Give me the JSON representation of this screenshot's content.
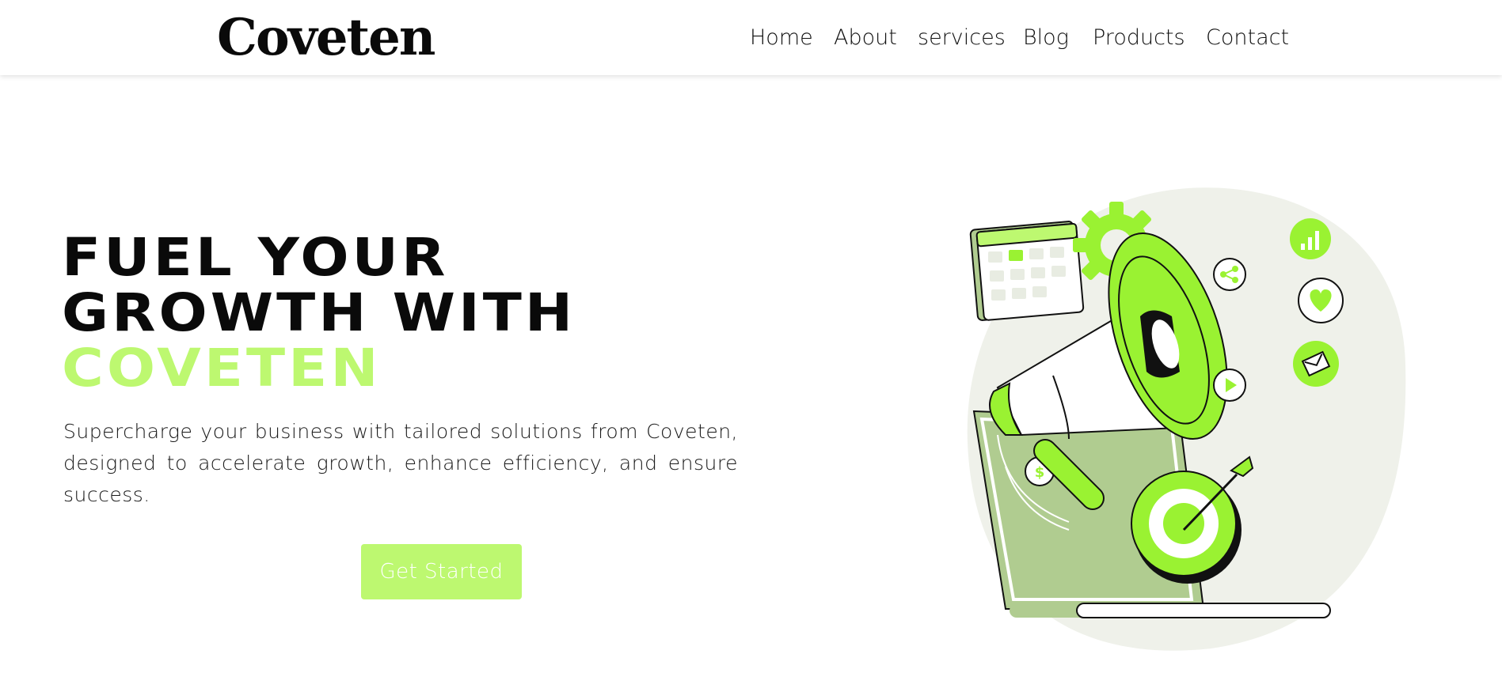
{
  "header": {
    "logo_text": "Coveten",
    "nav": [
      {
        "label": "Home"
      },
      {
        "label": "About"
      },
      {
        "label": "services"
      },
      {
        "label": "Blog"
      },
      {
        "label": "Products"
      },
      {
        "label": "Contact"
      }
    ]
  },
  "hero": {
    "title_line1": "Fuel Your",
    "title_line2": "Growth With",
    "title_line3": "Coveten",
    "description": "Supercharge your business with tailored solutions from Coveten, designed to accelerate growth, enhance efficiency, and ensure success.",
    "cta_label": "Get Started"
  },
  "illustration": {
    "icons": [
      "calendar-icon",
      "gear-icon",
      "megaphone-icon",
      "share-icon",
      "play-icon",
      "dollar-icon",
      "target-icon",
      "dart-icon",
      "chart-icon",
      "heart-icon",
      "mail-icon",
      "laptop-icon"
    ]
  },
  "colors": {
    "accent": "#bdf870",
    "accent_strong": "#9af232",
    "laptop_green": "#b0cc90",
    "blob": "#eff1ea",
    "text_dark": "#0a0a0a"
  }
}
